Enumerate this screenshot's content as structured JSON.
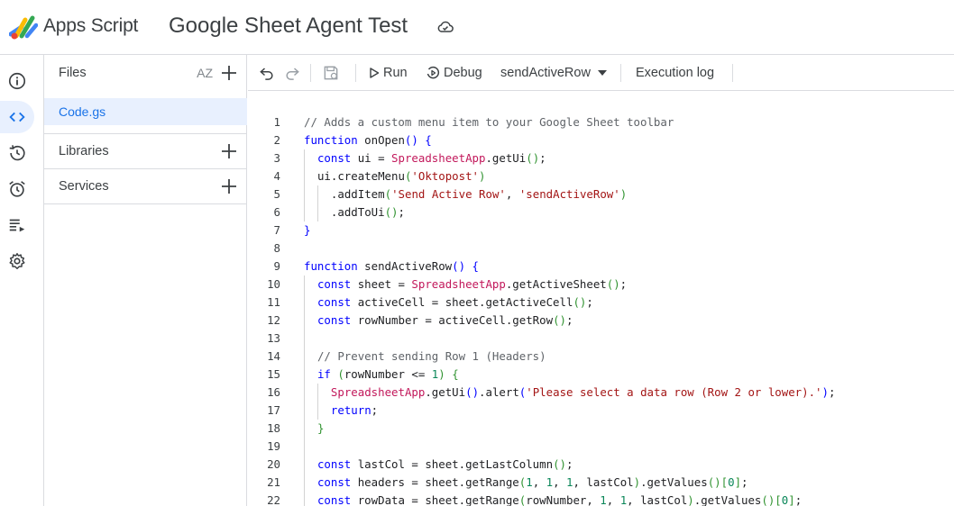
{
  "header": {
    "app_name": "Apps Script",
    "project_title": "Google Sheet Agent Test",
    "cloud_icon": "cloud-saved-icon"
  },
  "rail": {
    "items": [
      {
        "name": "overview",
        "icon": "info-icon"
      },
      {
        "name": "editor",
        "icon": "code-icon",
        "active": true
      },
      {
        "name": "executions",
        "icon": "history-icon"
      },
      {
        "name": "triggers",
        "icon": "alarm-icon"
      },
      {
        "name": "executions-list",
        "icon": "playlist-icon"
      },
      {
        "name": "settings",
        "icon": "gear-icon"
      }
    ]
  },
  "files_panel": {
    "files_label": "Files",
    "sort_label": "AZ",
    "files": [
      "Code.gs"
    ],
    "libraries_label": "Libraries",
    "services_label": "Services"
  },
  "toolbar": {
    "run_label": "Run",
    "debug_label": "Debug",
    "function_select": "sendActiveRow",
    "execution_log_label": "Execution log"
  },
  "editor": {
    "colors": {
      "keyword": "#0000ff",
      "comment": "#5f6368",
      "string": "#a31515",
      "class": "#c2185b",
      "number": "#098658",
      "paren": "#319331"
    },
    "lines": [
      {
        "n": "1",
        "indent": 0,
        "segs": [
          [
            "cm",
            "// Adds a custom menu item to your Google Sheet toolbar"
          ]
        ]
      },
      {
        "n": "2",
        "indent": 0,
        "segs": [
          [
            "kw",
            "function"
          ],
          [
            "",
            " onOpen"
          ],
          [
            "kw",
            "()"
          ],
          [
            "",
            " "
          ],
          [
            "kw",
            "{"
          ]
        ]
      },
      {
        "n": "3",
        "indent": 1,
        "segs": [
          [
            "kw",
            "const"
          ],
          [
            "",
            " ui = "
          ],
          [
            "cl",
            "SpreadsheetApp"
          ],
          [
            "",
            ".getUi"
          ],
          [
            "pa",
            "()"
          ],
          [
            "",
            ";"
          ]
        ]
      },
      {
        "n": "4",
        "indent": 1,
        "segs": [
          [
            "",
            "ui.createMenu"
          ],
          [
            "pa",
            "("
          ],
          [
            "st",
            "'Oktopost'"
          ],
          [
            "pa",
            ")"
          ]
        ]
      },
      {
        "n": "5",
        "indent": 2,
        "segs": [
          [
            "",
            ".addItem"
          ],
          [
            "pa",
            "("
          ],
          [
            "st",
            "'Send Active Row'"
          ],
          [
            "",
            ", "
          ],
          [
            "st",
            "'sendActiveRow'"
          ],
          [
            "pa",
            ")"
          ]
        ]
      },
      {
        "n": "6",
        "indent": 2,
        "segs": [
          [
            "",
            ".addToUi"
          ],
          [
            "pa",
            "()"
          ],
          [
            "",
            ";"
          ]
        ]
      },
      {
        "n": "7",
        "indent": 0,
        "segs": [
          [
            "kw",
            "}"
          ]
        ]
      },
      {
        "n": "8",
        "indent": 0,
        "segs": []
      },
      {
        "n": "9",
        "indent": 0,
        "segs": [
          [
            "kw",
            "function"
          ],
          [
            "",
            " sendActiveRow"
          ],
          [
            "kw",
            "()"
          ],
          [
            "",
            " "
          ],
          [
            "kw",
            "{"
          ]
        ]
      },
      {
        "n": "10",
        "indent": 1,
        "segs": [
          [
            "kw",
            "const"
          ],
          [
            "",
            " sheet = "
          ],
          [
            "cl",
            "SpreadsheetApp"
          ],
          [
            "",
            ".getActiveSheet"
          ],
          [
            "pa",
            "()"
          ],
          [
            "",
            ";"
          ]
        ]
      },
      {
        "n": "11",
        "indent": 1,
        "segs": [
          [
            "kw",
            "const"
          ],
          [
            "",
            " activeCell = sheet.getActiveCell"
          ],
          [
            "pa",
            "()"
          ],
          [
            "",
            ";"
          ]
        ]
      },
      {
        "n": "12",
        "indent": 1,
        "segs": [
          [
            "kw",
            "const"
          ],
          [
            "",
            " rowNumber = activeCell.getRow"
          ],
          [
            "pa",
            "()"
          ],
          [
            "",
            ";"
          ]
        ]
      },
      {
        "n": "13",
        "indent": 1,
        "segs": []
      },
      {
        "n": "14",
        "indent": 1,
        "segs": [
          [
            "cm",
            "// Prevent sending Row 1 (Headers)"
          ]
        ]
      },
      {
        "n": "15",
        "indent": 1,
        "segs": [
          [
            "kw",
            "if"
          ],
          [
            "",
            " "
          ],
          [
            "pa",
            "("
          ],
          [
            "",
            "rowNumber <= "
          ],
          [
            "num",
            "1"
          ],
          [
            "pa",
            ")"
          ],
          [
            "",
            " "
          ],
          [
            "pa",
            "{"
          ]
        ]
      },
      {
        "n": "16",
        "indent": 2,
        "segs": [
          [
            "cl",
            "SpreadsheetApp"
          ],
          [
            "",
            ".getUi"
          ],
          [
            "kw",
            "()"
          ],
          [
            "",
            ".alert"
          ],
          [
            "kw",
            "("
          ],
          [
            "st",
            "'Please select a data row (Row 2 or lower).'"
          ],
          [
            "kw",
            ")"
          ],
          [
            "",
            ";"
          ]
        ]
      },
      {
        "n": "17",
        "indent": 2,
        "segs": [
          [
            "kw",
            "return"
          ],
          [
            "",
            ";"
          ]
        ]
      },
      {
        "n": "18",
        "indent": 1,
        "segs": [
          [
            "pa",
            "}"
          ]
        ]
      },
      {
        "n": "19",
        "indent": 1,
        "segs": []
      },
      {
        "n": "20",
        "indent": 1,
        "segs": [
          [
            "kw",
            "const"
          ],
          [
            "",
            " lastCol = sheet.getLastColumn"
          ],
          [
            "pa",
            "()"
          ],
          [
            "",
            ";"
          ]
        ]
      },
      {
        "n": "21",
        "indent": 1,
        "segs": [
          [
            "kw",
            "const"
          ],
          [
            "",
            " headers = sheet.getRange"
          ],
          [
            "pa",
            "("
          ],
          [
            "num",
            "1"
          ],
          [
            "",
            ", "
          ],
          [
            "num",
            "1"
          ],
          [
            "",
            ", "
          ],
          [
            "num",
            "1"
          ],
          [
            "",
            ", lastCol"
          ],
          [
            "pa",
            ")"
          ],
          [
            "",
            ".getValues"
          ],
          [
            "pa",
            "()"
          ],
          [
            "pa",
            "["
          ],
          [
            "num",
            "0"
          ],
          [
            "pa",
            "]"
          ],
          [
            "",
            ";"
          ]
        ]
      },
      {
        "n": "22",
        "indent": 1,
        "segs": [
          [
            "kw",
            "const"
          ],
          [
            "",
            " rowData = sheet.getRange"
          ],
          [
            "pa",
            "("
          ],
          [
            "",
            "rowNumber, "
          ],
          [
            "num",
            "1"
          ],
          [
            "",
            ", "
          ],
          [
            "num",
            "1"
          ],
          [
            "",
            ", lastCol"
          ],
          [
            "pa",
            ")"
          ],
          [
            "",
            ".getValues"
          ],
          [
            "pa",
            "()"
          ],
          [
            "pa",
            "["
          ],
          [
            "num",
            "0"
          ],
          [
            "pa",
            "]"
          ],
          [
            "",
            ";"
          ]
        ]
      }
    ]
  }
}
